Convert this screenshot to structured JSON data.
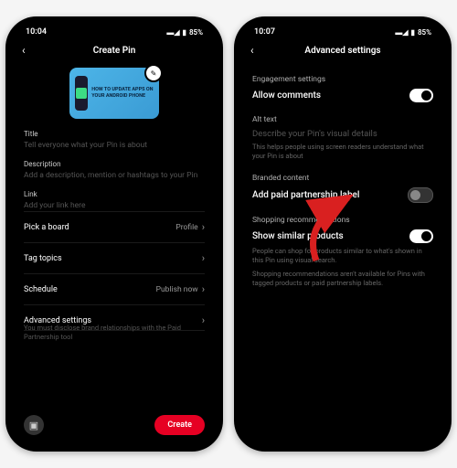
{
  "left": {
    "status": {
      "time": "10:04",
      "signal": "▬◢",
      "battery": "85%"
    },
    "header": {
      "title": "Create Pin"
    },
    "pin_image": {
      "text": "How to update apps on your Android phone",
      "edit_icon": "✎"
    },
    "fields": {
      "title_label": "Title",
      "title_placeholder": "Tell everyone what your Pin is about",
      "desc_label": "Description",
      "desc_placeholder": "Add a description, mention or hashtags to your Pin",
      "link_label": "Link",
      "link_placeholder": "Add your link here"
    },
    "rows": {
      "board": {
        "label": "Pick a board",
        "value": "Profile"
      },
      "tags": {
        "label": "Tag topics",
        "value": ""
      },
      "schedule": {
        "label": "Schedule",
        "value": "Publish now"
      },
      "advanced": {
        "label": "Advanced settings",
        "sub": "You must disclose brand relationships with the Paid Partnership tool"
      }
    },
    "footer": {
      "media_icon": "▣",
      "create_label": "Create"
    }
  },
  "right": {
    "status": {
      "time": "10:07",
      "signal": "▬◢",
      "battery": "85%"
    },
    "header": {
      "title": "Advanced settings"
    },
    "engagement": {
      "label": "Engagement settings",
      "allow_comments": "Allow comments"
    },
    "alt": {
      "label": "Alt text",
      "placeholder": "Describe your Pin's visual details",
      "help": "This helps people using screen readers understand what your Pin is about"
    },
    "branded": {
      "label": "Branded content",
      "paid": "Add paid partnership label"
    },
    "shop": {
      "label": "Shopping recommendations",
      "show": "Show similar products",
      "help1": "People can shop for products similar to what's shown in this Pin using visual search.",
      "help2": "Shopping recommendations aren't available for Pins with tagged products or paid partnership labels."
    }
  }
}
